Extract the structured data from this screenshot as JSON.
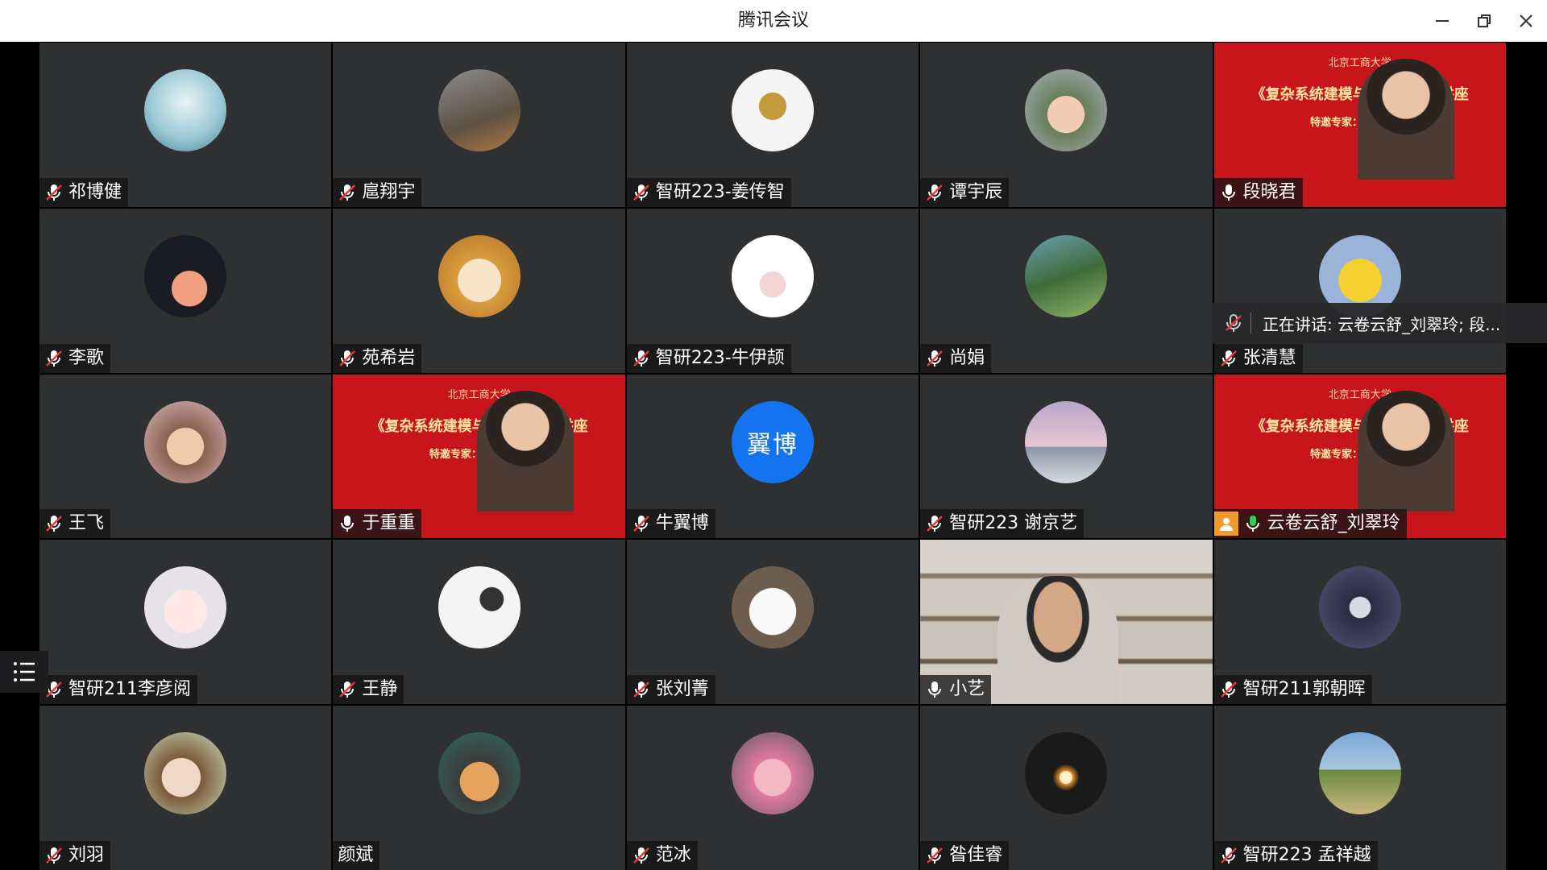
{
  "window": {
    "title": "腾讯会议"
  },
  "speaking_banner": {
    "text": "正在讲话: 云卷云舒_刘翠玲; 段..."
  },
  "banner_slide": {
    "university": "北京工商大学",
    "series": "《复杂系统建模与分析》系列讲座",
    "guest": "特邀专家：　　　教授"
  },
  "tiles": [
    {
      "name": "祁博健",
      "mic": "muted",
      "avatar": "anime-swordsman-avatar"
    },
    {
      "name": "扈翔宇",
      "mic": "muted",
      "avatar": "tree-cat-avatar"
    },
    {
      "name": "智研223-姜传智",
      "mic": "muted",
      "avatar": "champions-crown-avatar"
    },
    {
      "name": "谭宇辰",
      "mic": "muted",
      "avatar": "child-photo-avatar"
    },
    {
      "name": "段晓君",
      "mic": "on",
      "avatar": "video-banner"
    },
    {
      "name": "李歌",
      "mic": "muted",
      "avatar": "orange-flower-avatar"
    },
    {
      "name": "苑希岩",
      "mic": "muted",
      "avatar": "cartoon-cat-avatar"
    },
    {
      "name": "智研223-牛伊颉",
      "mic": "muted",
      "avatar": "cow-avatar"
    },
    {
      "name": "尚娟",
      "mic": "muted",
      "avatar": "garden-avatar"
    },
    {
      "name": "张清慧",
      "mic": "muted",
      "avatar": "pikachu-avatar"
    },
    {
      "name": "王飞",
      "mic": "muted",
      "avatar": "cartoon-girl-avatar"
    },
    {
      "name": "于重重",
      "mic": "on",
      "avatar": "video-banner"
    },
    {
      "name": "牛翼博",
      "mic": "muted",
      "avatar": "initials",
      "initials": "翼博"
    },
    {
      "name": "智研223 谢京艺",
      "mic": "muted",
      "avatar": "mountain-moon-avatar"
    },
    {
      "name": "云卷云舒_刘翠玲",
      "mic": "active",
      "avatar": "video-banner",
      "host": true
    },
    {
      "name": "智研211李彦阅",
      "mic": "muted",
      "avatar": "anime-white-hair-avatar"
    },
    {
      "name": "王静",
      "mic": "muted",
      "avatar": "sketch-girl-avatar"
    },
    {
      "name": "张刘菁",
      "mic": "muted",
      "avatar": "white-puppy-avatar"
    },
    {
      "name": "小艺",
      "mic": "on",
      "avatar": "video-bookshelf"
    },
    {
      "name": "智研211郭朝晖",
      "mic": "muted",
      "avatar": "anime-dark-hair-avatar"
    },
    {
      "name": "刘羽",
      "mic": "muted",
      "avatar": "anime-sleeping-avatar"
    },
    {
      "name": "颜斌",
      "mic": "none",
      "avatar": "orange-cat-avatar"
    },
    {
      "name": "范冰",
      "mic": "muted",
      "avatar": "pink-hair-avatar"
    },
    {
      "name": "昝佳睿",
      "mic": "muted",
      "avatar": "candle-avatar"
    },
    {
      "name": "智研223 孟祥越",
      "mic": "muted",
      "avatar": "landscape-avatar"
    }
  ],
  "colors": {
    "tile_bg": "#2f3032",
    "active_mic": "#2cb34a",
    "initials_bg": "#1474f0",
    "banner_red": "#c8151b"
  }
}
